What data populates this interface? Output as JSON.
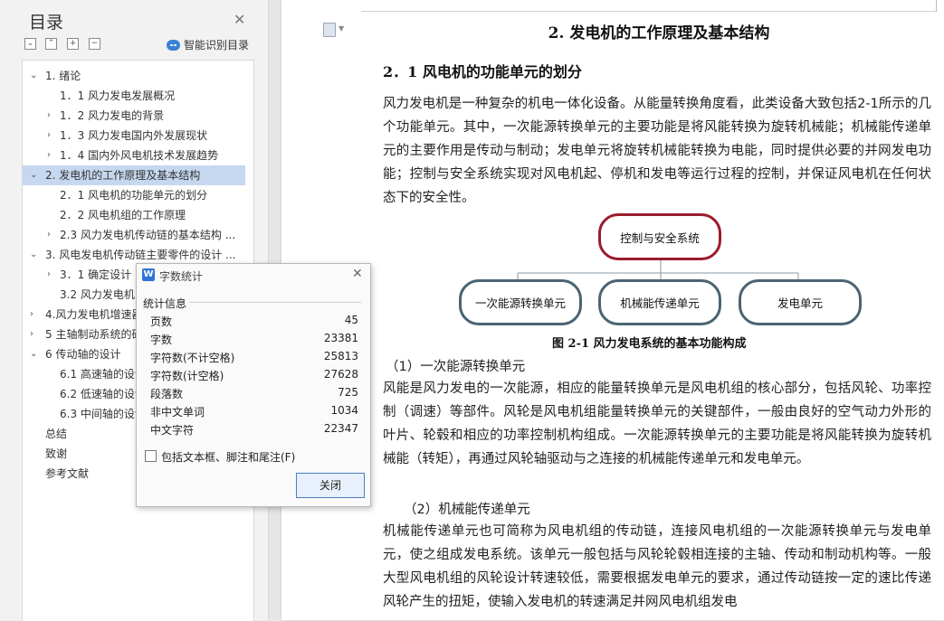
{
  "nav": {
    "title": "目录",
    "smart_label": "智能识别目录",
    "toolbar": [
      "⌄",
      "⌃",
      "+",
      "−"
    ],
    "items": [
      {
        "arrow": "⌄",
        "label": "1.  绪论",
        "indent": 0
      },
      {
        "arrow": "",
        "label": "1．1    风力发电发展概况",
        "indent": 1
      },
      {
        "arrow": "›",
        "label": "1．2    风力发电的背景",
        "indent": 1
      },
      {
        "arrow": "›",
        "label": "1．3    风力发电国内外发展现状",
        "indent": 1
      },
      {
        "arrow": "›",
        "label": "1．4    国内外风电机技术发展趋势",
        "indent": 1
      },
      {
        "arrow": "⌄",
        "label": "2.   发电机的工作原理及基本结构",
        "indent": 0,
        "selected": true
      },
      {
        "arrow": "",
        "label": "2．1    风电机的功能单元的划分",
        "indent": 1
      },
      {
        "arrow": "",
        "label": "2．2    风电机组的工作原理",
        "indent": 1
      },
      {
        "arrow": "›",
        "label": "2.3    风力发电机传动链的基本结构 ...",
        "indent": 1
      },
      {
        "arrow": "⌄",
        "label": "3.   风电发电机传动链主要零件的设计 ...",
        "indent": 0
      },
      {
        "arrow": "›",
        "label": "3．1    确定设计",
        "indent": 1
      },
      {
        "arrow": "",
        "label": "3.2    风力发电机",
        "indent": 1
      },
      {
        "arrow": "›",
        "label": "4.风力发电机增速器",
        "indent": 0
      },
      {
        "arrow": "›",
        "label": "5 主轴制动系统的研",
        "indent": 0
      },
      {
        "arrow": "⌄",
        "label": "6 传动轴的设计",
        "indent": 0
      },
      {
        "arrow": "",
        "label": "6.1 高速轴的设计",
        "indent": 1
      },
      {
        "arrow": "",
        "label": "6.2 低速轴的设计",
        "indent": 1
      },
      {
        "arrow": "",
        "label": "6.3 中间轴的设计",
        "indent": 1
      },
      {
        "arrow": "",
        "label": "总结",
        "indent": 0
      },
      {
        "arrow": "",
        "label": "致谢",
        "indent": 0
      },
      {
        "arrow": "",
        "label": "参考文献",
        "indent": 0
      }
    ]
  },
  "doc": {
    "chapter_title": "2.   发电机的工作原理及基本结构",
    "section_title": "2．1    风电机的功能单元的划分",
    "para1": "    风力发电机是一种复杂的机电一体化设备。从能量转换角度看，此类设备大致包括2-1所示的几个功能单元。其中，一次能源转换单元的主要功能是将风能转换为旋转机械能；机械能传递单元的主要作用是传动与制动；发电单元将旋转机械能转换为电能，同时提供必要的并网发电功能；控制与安全系统实现对风电机起、停机和发电等运行过程的控制，并保证风电机在任何状态下的安全性。",
    "diagram": {
      "top": "控制与安全系统",
      "left": "一次能源转换单元",
      "middle": "机械能传递单元",
      "right": "发电单元",
      "color_top": "#9b1c2e",
      "color_bottom": "#4a6472"
    },
    "caption": "图 2-1    风力发电系统的基本功能构成",
    "sub1": "（1）一次能源转换单元",
    "para2": "    风能是风力发电的一次能源，相应的能量转换单元是风电机组的核心部分，包括风轮、功率控制（调速）等部件。风轮是风电机组能量转换单元的关键部件，一般由良好的空气动力外形的叶片、轮毂和相应的功率控制机构组成。一次能源转换单元的主要功能是将风能转换为旋转机械能（转矩），再通过风轮轴驱动与之连接的机械能传递单元和发电单元。",
    "sub2": "（2）机械能传递单元",
    "para3": "      机械能传递单元也可简称为风电机组的传动链，连接风电机组的一次能源转换单元与发电单元，使之组成发电系统。该单元一般包括与风轮轮毂相连接的主轴、传动和制动机构等。一般大型风电机组的风轮设计转速较低，需要根据发电单元的要求，通过传动链按一定的速比传递风轮产生的扭矩，使输入发电机的转速满足并网风电机组发电"
  },
  "dialog": {
    "title": "字数统计",
    "icon_letter": "W",
    "group_label": "统计信息",
    "stats": [
      {
        "label": "页数",
        "value": "45"
      },
      {
        "label": "字数",
        "value": "23381"
      },
      {
        "label": "字符数(不计空格)",
        "value": "25813"
      },
      {
        "label": "字符数(计空格)",
        "value": "27628"
      },
      {
        "label": "段落数",
        "value": "725"
      },
      {
        "label": "非中文单词",
        "value": "1034"
      },
      {
        "label": "中文字符",
        "value": "22347"
      }
    ],
    "checkbox_label": "包括文本框、脚注和尾注(F)",
    "close_button": "关闭",
    "accent": "#2e74d6"
  }
}
